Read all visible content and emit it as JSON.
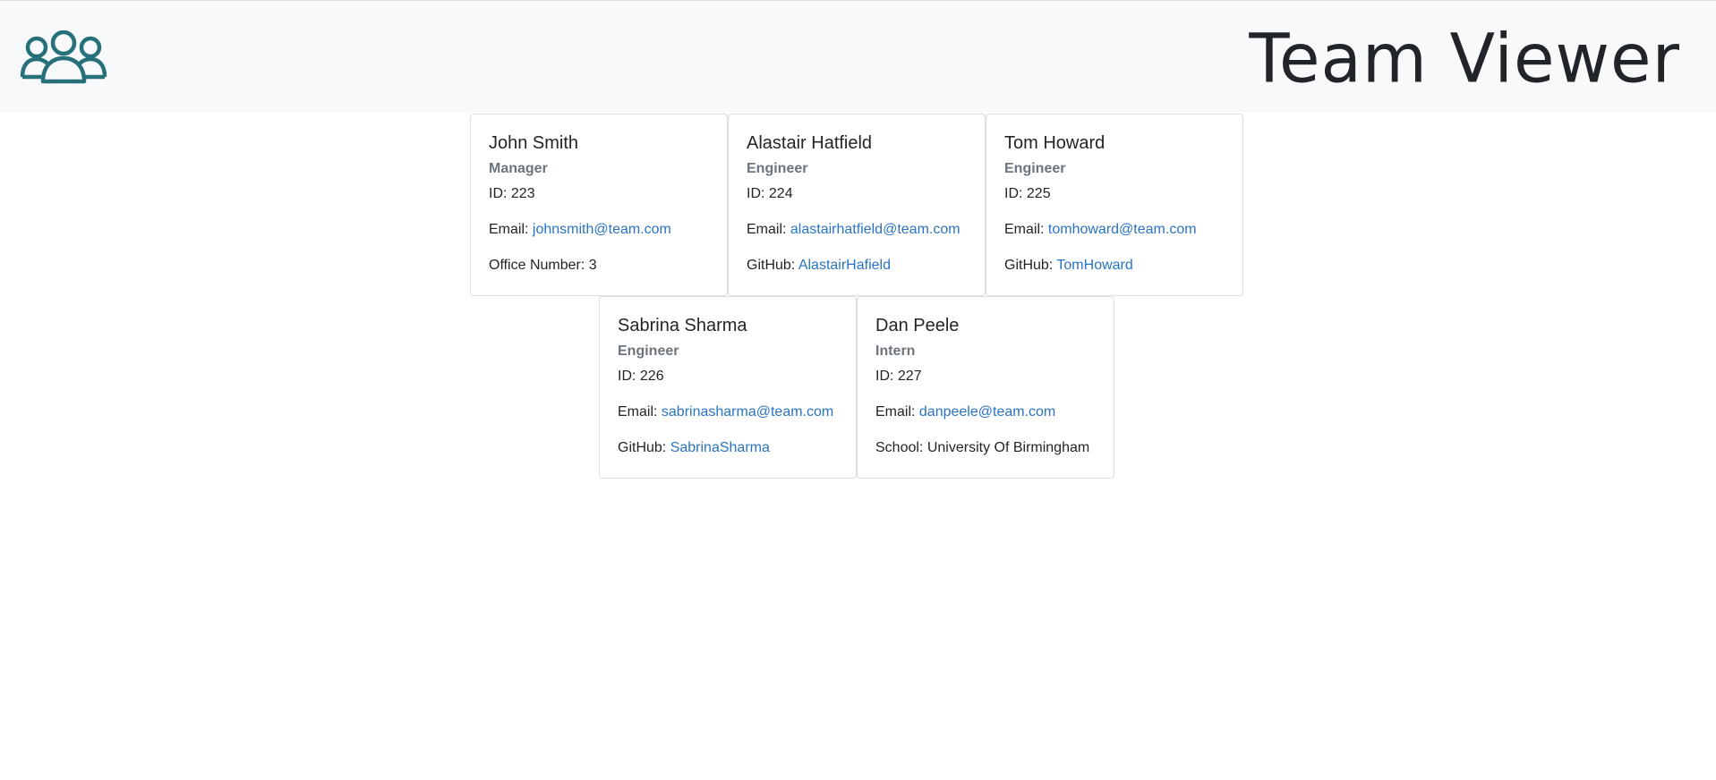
{
  "header": {
    "title": "Team Viewer",
    "logo_icon": "users-group-icon",
    "logo_color": "#26707a"
  },
  "employees": [
    {
      "name": "John Smith",
      "role": "Manager",
      "id_label": "ID: 223",
      "email_label": "Email:",
      "email": "johnsmith@team.com",
      "extra_label": "Office Number:",
      "extra_value": "3"
    },
    {
      "name": "Alastair Hatfield",
      "role": "Engineer",
      "id_label": "ID: 224",
      "email_label": "Email:",
      "email": "alastairhatfield@team.com",
      "extra_label": "GitHub:",
      "extra_value": "AlastairHafield"
    },
    {
      "name": "Tom Howard",
      "role": "Engineer",
      "id_label": "ID: 225",
      "email_label": "Email:",
      "email": "tomhoward@team.com",
      "extra_label": "GitHub:",
      "extra_value": "TomHoward"
    },
    {
      "name": "Sabrina Sharma",
      "role": "Engineer",
      "id_label": "ID: 226",
      "email_label": "Email:",
      "email": "sabrinasharma@team.com",
      "extra_label": "GitHub:",
      "extra_value": "SabrinaSharma"
    },
    {
      "name": "Dan Peele",
      "role": "Intern",
      "id_label": "ID: 227",
      "email_label": "Email:",
      "email": "danpeele@team.com",
      "extra_label": "School:",
      "extra_value": "University Of Birmingham"
    }
  ],
  "colors": {
    "link": "#2a74c4",
    "muted": "#6c757d",
    "navbar_bg": "#f8f9fa"
  }
}
